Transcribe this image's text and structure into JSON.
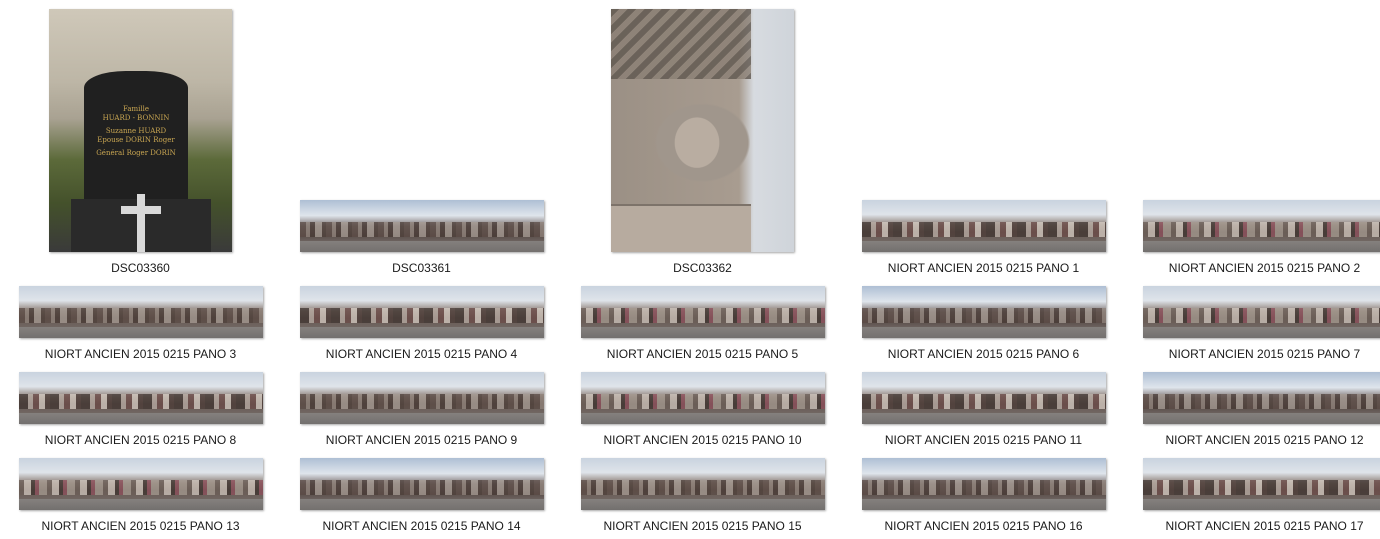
{
  "window": {
    "view": "large-icons"
  },
  "items": [
    {
      "name": "DSC03360",
      "kind": "grave-photo"
    },
    {
      "name": "DSC03361",
      "kind": "panorama"
    },
    {
      "name": "DSC03362",
      "kind": "angel-photo"
    },
    {
      "name": "NIORT ANCIEN 2015 0215 PANO 1",
      "kind": "panorama"
    },
    {
      "name": "NIORT ANCIEN 2015 0215 PANO 2",
      "kind": "panorama"
    },
    {
      "name": "NIORT ANCIEN 2015 0215 PANO 3",
      "kind": "panorama"
    },
    {
      "name": "NIORT ANCIEN 2015 0215 PANO 4",
      "kind": "panorama"
    },
    {
      "name": "NIORT ANCIEN 2015 0215 PANO 5",
      "kind": "panorama"
    },
    {
      "name": "NIORT ANCIEN 2015 0215 PANO 6",
      "kind": "panorama"
    },
    {
      "name": "NIORT ANCIEN 2015 0215 PANO 7",
      "kind": "panorama"
    },
    {
      "name": "NIORT ANCIEN 2015 0215 PANO 8",
      "kind": "panorama"
    },
    {
      "name": "NIORT ANCIEN 2015 0215 PANO 9",
      "kind": "panorama"
    },
    {
      "name": "NIORT ANCIEN 2015 0215 PANO 10",
      "kind": "panorama"
    },
    {
      "name": "NIORT ANCIEN 2015 0215 PANO 11",
      "kind": "panorama"
    },
    {
      "name": "NIORT ANCIEN 2015 0215 PANO 12",
      "kind": "panorama"
    },
    {
      "name": "NIORT ANCIEN 2015 0215 PANO 13",
      "kind": "panorama"
    },
    {
      "name": "NIORT ANCIEN 2015 0215 PANO 14",
      "kind": "panorama"
    },
    {
      "name": "NIORT ANCIEN 2015 0215 PANO 15",
      "kind": "panorama"
    },
    {
      "name": "NIORT ANCIEN 2015 0215 PANO 16",
      "kind": "panorama"
    },
    {
      "name": "NIORT ANCIEN 2015 0215 PANO 17",
      "kind": "panorama"
    }
  ],
  "headstone": {
    "line1": "Famille",
    "line2": "HUARD - BONNIN",
    "line3": "Suzanne HUARD",
    "line4": "Epouse DORIN Roger",
    "line5": "Général Roger DORIN"
  }
}
